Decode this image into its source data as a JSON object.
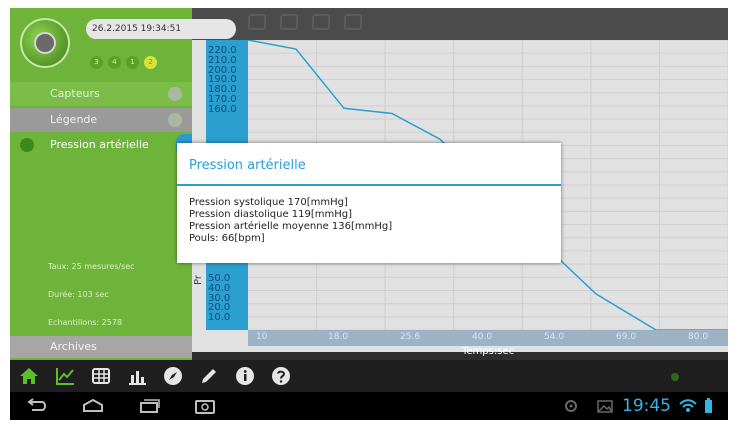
{
  "header": {
    "datetime": "26.2.2015 19:34:51",
    "profiles": [
      "3",
      "4",
      "1",
      "2"
    ]
  },
  "sidebar": {
    "capteurs_label": "Capteurs",
    "legende_label": "Légende",
    "selected_sensor": "Pression artérielle",
    "stats": {
      "taux": "Taux: 25 mesures/sec",
      "duree": "Durée: 103 sec",
      "echantillons": "Echantillons: 2578"
    },
    "archives_label": "Archives"
  },
  "chart_data": {
    "type": "line",
    "xlabel": "Temps:sec",
    "ylabel": "Pr",
    "y_ticks": [
      "220.0",
      "210.0",
      "200.0",
      "190.0",
      "180.0",
      "170.0",
      "160.0",
      "50.0",
      "40.0",
      "30.0",
      "20.0",
      "10.0"
    ],
    "x_ticks": [
      "10",
      "18.0",
      "25.6",
      "40.0",
      "54.0",
      "69.0",
      "80.0"
    ],
    "ylim": [
      0,
      225
    ],
    "grid": true,
    "series": [
      {
        "x": [
          0,
          8,
          16,
          24,
          32,
          40,
          48,
          58,
          68,
          80
        ],
        "values": [
          225,
          218,
          172,
          168,
          148,
          112,
          72,
          28,
          0,
          0
        ]
      }
    ]
  },
  "dialog": {
    "title": "Pression artérielle",
    "systolic": "Pression systolique  170[mmHg]",
    "diastolic": "Pression diastolique  119[mmHg]",
    "mean": "Pression artérielle moyenne  136[mmHg]",
    "pulse": "Pouls:  66[bpm]"
  },
  "status_bar": {
    "time": "19:45"
  },
  "colors": {
    "accent_green": "#6fb43a",
    "accent_blue": "#2a9fd6"
  }
}
